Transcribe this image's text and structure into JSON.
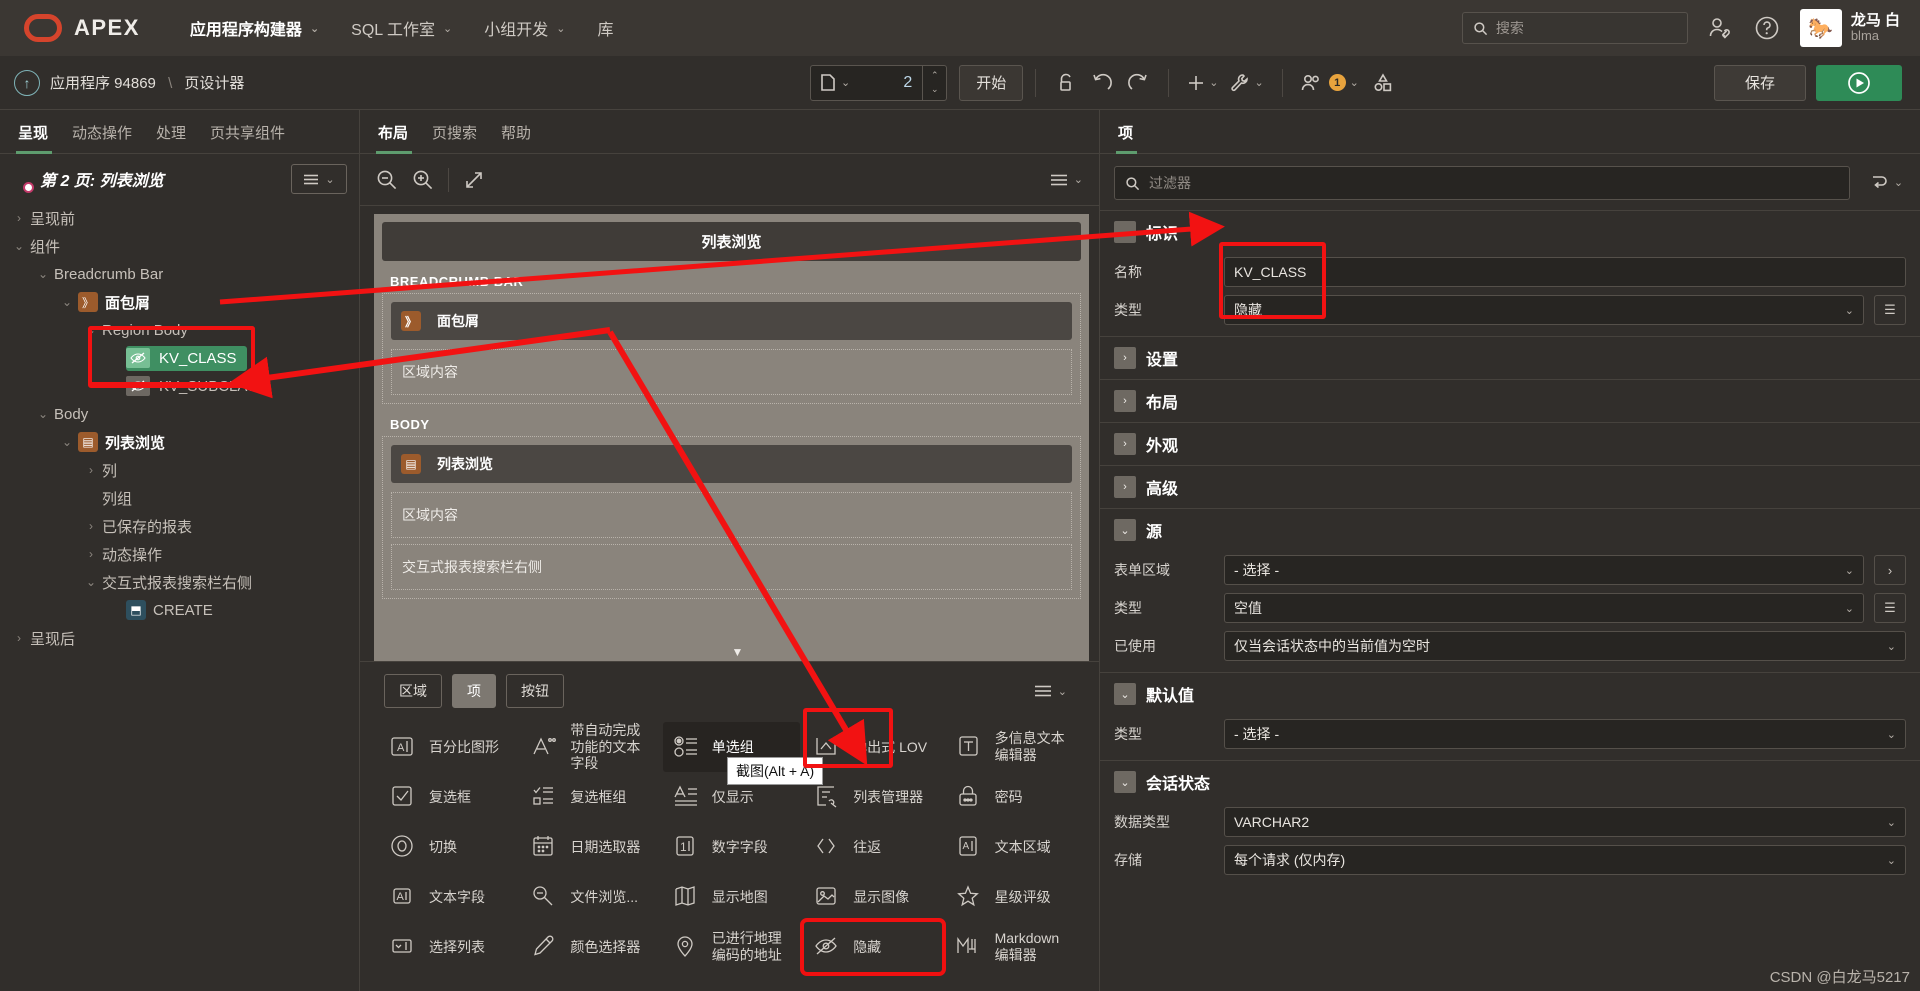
{
  "topnav": {
    "brand": "APEX",
    "items": [
      {
        "label": "应用程序构建器",
        "caret": "⌄",
        "active": true
      },
      {
        "label": "SQL 工作室",
        "caret": "⌄",
        "active": false
      },
      {
        "label": "小组开发",
        "caret": "⌄",
        "active": false
      },
      {
        "label": "库",
        "caret": "",
        "active": false
      }
    ],
    "search_placeholder": "搜索",
    "user_name": "龙马 白",
    "user_id": "blma",
    "icons": [
      "search-icon",
      "admin-user-icon",
      "help-icon",
      "avatar"
    ]
  },
  "toolbar": {
    "up_arrow": "↑",
    "breadcrumb_app": "应用程序 94869",
    "breadcrumb_sep": "\\",
    "breadcrumb_page": "页设计器",
    "page_number": "2",
    "start_label": "开始",
    "save_label": "保存",
    "badge_count": "1"
  },
  "left_panel": {
    "tabs": [
      {
        "label": "呈现",
        "active": true
      },
      {
        "label": "动态操作",
        "active": false
      },
      {
        "label": "处理",
        "active": false
      },
      {
        "label": "页共享组件",
        "active": false
      }
    ],
    "tree_title": "第 2 页: 列表浏览",
    "tree": [
      {
        "label": "呈现前",
        "depth": 0,
        "tw": "›",
        "icon": ""
      },
      {
        "label": "组件",
        "depth": 0,
        "tw": "⌄",
        "icon": ""
      },
      {
        "label": "Breadcrumb Bar",
        "depth": 1,
        "tw": "⌄",
        "icon": ""
      },
      {
        "label": "面包屑",
        "depth": 2,
        "tw": "⌄",
        "icon": "breadcrumb-icon",
        "bold": true
      },
      {
        "label": "Region Body",
        "depth": 3,
        "tw": "⌄",
        "icon": ""
      },
      {
        "label": "KV_CLASS",
        "depth": 4,
        "tw": "",
        "icon": "hidden-item-icon",
        "selected": true
      },
      {
        "label": "KV_SUBCLASS",
        "depth": 4,
        "tw": "",
        "icon": "hidden-item-icon"
      },
      {
        "label": "Body",
        "depth": 1,
        "tw": "⌄",
        "icon": ""
      },
      {
        "label": "列表浏览",
        "depth": 2,
        "tw": "⌄",
        "icon": "report-icon",
        "bold": true
      },
      {
        "label": "列",
        "depth": 3,
        "tw": "›",
        "icon": ""
      },
      {
        "label": "列组",
        "depth": 3,
        "tw": "",
        "icon": ""
      },
      {
        "label": "已保存的报表",
        "depth": 3,
        "tw": "›",
        "icon": ""
      },
      {
        "label": "动态操作",
        "depth": 3,
        "tw": "›",
        "icon": ""
      },
      {
        "label": "交互式报表搜索栏右侧",
        "depth": 3,
        "tw": "⌄",
        "icon": ""
      },
      {
        "label": "CREATE",
        "depth": 4,
        "tw": "",
        "icon": "create-button-icon"
      },
      {
        "label": "呈现后",
        "depth": 0,
        "tw": "›",
        "icon": ""
      }
    ]
  },
  "mid_panel": {
    "tabs": [
      {
        "label": "布局",
        "active": true
      },
      {
        "label": "页搜索",
        "active": false
      },
      {
        "label": "帮助",
        "active": false
      }
    ],
    "zoom_icons": [
      "zoom-out-icon",
      "zoom-in-icon",
      "expand-icon"
    ],
    "page_title": "列表浏览",
    "zones": [
      {
        "label": "BREADCRUMB BAR",
        "region": "面包屑",
        "region_icon": "breadcrumb-icon",
        "body": "区域内容"
      },
      {
        "label": "BODY",
        "region": "列表浏览",
        "region_icon": "report-icon",
        "body": "区域内容",
        "extra": "交互式报表搜索栏右侧"
      }
    ]
  },
  "gallery": {
    "tabs": [
      {
        "label": "区域",
        "active": false
      },
      {
        "label": "项",
        "active": true
      },
      {
        "label": "按钮",
        "active": false
      }
    ],
    "tooltip": "截图(Alt + A)",
    "items": [
      {
        "label": "百分比图形",
        "icon": "percent-graph-icon"
      },
      {
        "label": "带自动完成功能的文本字段",
        "icon": "autocomplete-text-field-icon"
      },
      {
        "label": "单选组",
        "icon": "radio-group-icon",
        "highlighted": true
      },
      {
        "label": "弹出式 LOV",
        "icon": "popup-lov-icon"
      },
      {
        "label": "多信息文本编辑器",
        "icon": "rich-text-editor-icon"
      },
      {
        "label": "复选框",
        "icon": "checkbox-icon"
      },
      {
        "label": "复选框组",
        "icon": "checkbox-group-icon"
      },
      {
        "label": "仅显示",
        "icon": "display-only-icon"
      },
      {
        "label": "列表管理器",
        "icon": "list-manager-icon"
      },
      {
        "label": "密码",
        "icon": "password-icon"
      },
      {
        "label": "切换",
        "icon": "switch-icon"
      },
      {
        "label": "日期选取器",
        "icon": "date-picker-icon"
      },
      {
        "label": "数字字段",
        "icon": "number-field-icon"
      },
      {
        "label": "往返",
        "icon": "shuttle-icon"
      },
      {
        "label": "文本区域",
        "icon": "textarea-icon"
      },
      {
        "label": "文本字段",
        "icon": "text-field-icon"
      },
      {
        "label": "文件浏览...",
        "icon": "file-browse-icon"
      },
      {
        "label": "显示地图",
        "icon": "display-map-icon"
      },
      {
        "label": "显示图像",
        "icon": "display-image-icon"
      },
      {
        "label": "星级评级",
        "icon": "star-rating-icon"
      },
      {
        "label": "选择列表",
        "icon": "select-list-icon"
      },
      {
        "label": "颜色选择器",
        "icon": "color-picker-icon"
      },
      {
        "label": "已进行地理编码的地址",
        "icon": "geocoded-address-icon"
      },
      {
        "label": "隐藏",
        "icon": "hidden-icon",
        "boxed": true
      },
      {
        "label": "Markdown 编辑器",
        "icon": "markdown-editor-icon"
      }
    ]
  },
  "right_panel": {
    "tab": "项",
    "filter_placeholder": "过滤器",
    "sections": [
      {
        "title": "标识",
        "expanded": true,
        "rows": [
          {
            "label": "名称",
            "value": "KV_CLASS",
            "type": "text"
          },
          {
            "label": "类型",
            "value": "隐藏",
            "type": "select",
            "has_button": true
          }
        ]
      },
      {
        "title": "设置",
        "expanded": false,
        "rows": []
      },
      {
        "title": "布局",
        "expanded": false,
        "rows": []
      },
      {
        "title": "外观",
        "expanded": false,
        "rows": []
      },
      {
        "title": "高级",
        "expanded": false,
        "rows": []
      },
      {
        "title": "源",
        "expanded": true,
        "rows": [
          {
            "label": "表单区域",
            "value": "- 选择 -",
            "type": "select",
            "has_button": true,
            "button_glyph": "›"
          },
          {
            "label": "类型",
            "value": "空值",
            "type": "select",
            "has_button": true
          },
          {
            "label": "已使用",
            "value": "仅当会话状态中的当前值为空时",
            "type": "select"
          }
        ]
      },
      {
        "title": "默认值",
        "expanded": true,
        "rows": [
          {
            "label": "类型",
            "value": "- 选择 -",
            "type": "select"
          }
        ]
      },
      {
        "title": "会话状态",
        "expanded": true,
        "rows": [
          {
            "label": "数据类型",
            "value": "VARCHAR2",
            "type": "select"
          },
          {
            "label": "存储",
            "value": "每个请求 (仅内存)",
            "type": "select"
          }
        ]
      }
    ]
  },
  "watermark": "CSDN @白龙马5217",
  "colors": {
    "accent_green": "#2e8b57",
    "annotation_red": "#f21212",
    "brand_red": "#d5442c",
    "selected_green": "#3f8f62"
  }
}
